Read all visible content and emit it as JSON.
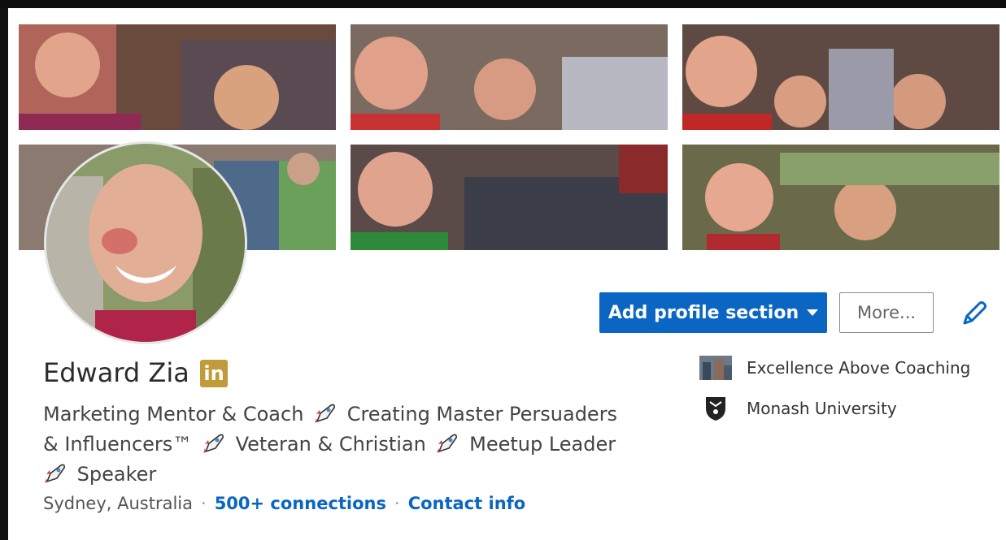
{
  "profile": {
    "name": "Edward Zia",
    "premium_badge": "in",
    "headline_lines": [
      [
        "Marketing Mentor & Coach",
        "Creating Master Persuaders"
      ],
      [
        "& Influencers™",
        "Veteran & Christian",
        "Meetup Leader"
      ],
      [
        "",
        "Speaker"
      ]
    ],
    "location": "Sydney, Australia",
    "connections": "500+ connections",
    "contact_info": "Contact info"
  },
  "actions": {
    "add_section": "Add profile section",
    "more": "More..."
  },
  "organizations": [
    {
      "name": "Excellence Above Coaching",
      "icon": "company-logo-icon"
    },
    {
      "name": "Monash University",
      "icon": "university-crest-icon"
    }
  ],
  "colors": {
    "brand_blue": "#0a66c2",
    "premium_gold": "#c09b3a"
  },
  "icons": {
    "rocket": "rocket-icon",
    "edit": "pencil-icon",
    "dropdown": "caret-down-icon"
  }
}
